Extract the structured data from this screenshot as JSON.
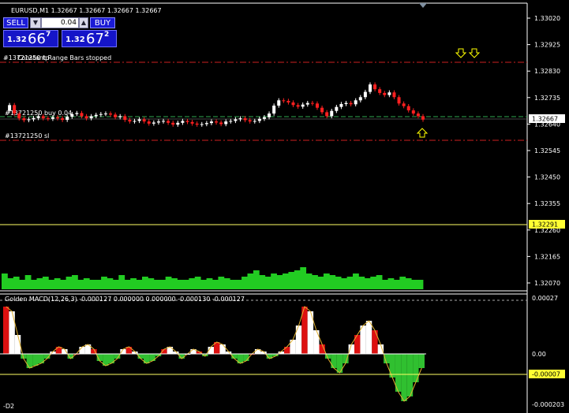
{
  "chart": {
    "title": "EURUSD,M1  1.32667 1.32667 1.32667 1.32667",
    "sell_label": "SELL",
    "buy_label": "BUY",
    "lot_value": "0.04",
    "bid": {
      "small": "1.32",
      "big": "66",
      "sup": "7"
    },
    "ask": {
      "small": "1.32",
      "big": "67",
      "sup": "2"
    },
    "status_text": "Constant Range Bars stopped",
    "tp_line_label": "#13721250 tp",
    "order_label": "#13721250 buy 0.04",
    "sl_label": "#13721250 sl",
    "current_price": "1.32667",
    "hline_price": "1.32291",
    "indicator_label": "Golden MACD(12,26,3) -0.000127 0.000000 0.000000 -0.000130 -0.000127",
    "subwindow_label": "-D2",
    "price_ticks": [
      "1.33020",
      "1.32925",
      "1.32830",
      "1.32735",
      "1.32640",
      "1.32545",
      "1.32450",
      "1.32355",
      "1.32260",
      "1.32165",
      "1.32070"
    ],
    "macd_ticks": [
      "0.00027",
      "0.00",
      "-0.00007",
      "-0.000203"
    ]
  },
  "colors": {
    "background": "#000000",
    "grid_line": "#ffffff",
    "bull": "#ffffff",
    "bear": "#ff2020",
    "volume": "#22cc22",
    "tp_sl_line": "#cc2020",
    "order_line": "#2fa84f",
    "hline": "#ffff66",
    "macd_pos": "#ffffff",
    "macd_neg": "#30c030",
    "macd_hist_red": "#dd1010",
    "arrow": "#ffff00"
  },
  "chart_data": {
    "type": "candlestick",
    "symbol": "EURUSD",
    "timeframe": "M1",
    "ylim": [
      1.3204,
      1.3306
    ],
    "close_series": [
      1.327,
      1.32722,
      1.3269,
      1.32672,
      1.32665,
      1.32668,
      1.32673,
      1.3268,
      1.32672,
      1.3267,
      1.32676,
      1.32672,
      1.32666,
      1.32678,
      1.32688,
      1.32692,
      1.3268,
      1.32672,
      1.3268,
      1.32685,
      1.32688,
      1.3269,
      1.32686,
      1.32676,
      1.3268,
      1.32666,
      1.3266,
      1.32662,
      1.32668,
      1.3266,
      1.32652,
      1.32656,
      1.3266,
      1.32662,
      1.32655,
      1.32648,
      1.32655,
      1.32662,
      1.32658,
      1.32652,
      1.32648,
      1.3265,
      1.32654,
      1.3266,
      1.32656,
      1.3265,
      1.3266,
      1.32662,
      1.32668,
      1.32672,
      1.32665,
      1.3266,
      1.32662,
      1.3267,
      1.32676,
      1.3269,
      1.3272,
      1.3274,
      1.32738,
      1.32732,
      1.32722,
      1.32716,
      1.32724,
      1.3273,
      1.32728,
      1.32712,
      1.32695,
      1.3268,
      1.327,
      1.32715,
      1.32726,
      1.3273,
      1.32725,
      1.3274,
      1.32752,
      1.32772,
      1.328,
      1.32782,
      1.32768,
      1.3276,
      1.3277,
      1.32752,
      1.32728,
      1.32718,
      1.32702,
      1.3269,
      1.3268,
      1.32667
    ],
    "macd_hist": [
      0.0002,
      0.00018,
      8e-05,
      -2e-05,
      -6e-05,
      -5e-05,
      -4e-05,
      -2e-05,
      1e-05,
      3e-05,
      2e-05,
      -2e-05,
      0.0,
      3e-05,
      4e-05,
      2e-05,
      -3e-05,
      -5e-05,
      -4e-05,
      -2e-05,
      2e-05,
      3e-05,
      1e-05,
      -2e-05,
      -4e-05,
      -3e-05,
      -1e-05,
      2e-05,
      3e-05,
      1e-05,
      -2e-05,
      0.0,
      2e-05,
      1e-05,
      -1e-05,
      3e-05,
      5e-05,
      4e-05,
      1e-05,
      -2e-05,
      -4e-05,
      -3e-05,
      0.0,
      2e-05,
      1e-05,
      -2e-05,
      -1e-05,
      1e-05,
      3e-05,
      6e-05,
      0.00012,
      0.0002,
      0.00018,
      0.0001,
      4e-05,
      -2e-05,
      -6e-05,
      -8e-05,
      -4e-05,
      4e-05,
      8e-05,
      0.00012,
      0.00014,
      0.0001,
      4e-05,
      -4e-05,
      -0.0001,
      -0.00016,
      -0.0002,
      -0.00018,
      -0.00012,
      -6e-05
    ],
    "volume": [
      0.5,
      0.35,
      0.4,
      0.3,
      0.45,
      0.3,
      0.35,
      0.4,
      0.3,
      0.35,
      0.3,
      0.4,
      0.45,
      0.3,
      0.35,
      0.3,
      0.3,
      0.4,
      0.35,
      0.3,
      0.45,
      0.3,
      0.35,
      0.3,
      0.4,
      0.35,
      0.3,
      0.3,
      0.4,
      0.35,
      0.3,
      0.3,
      0.35,
      0.4,
      0.3,
      0.35,
      0.3,
      0.4,
      0.35,
      0.3,
      0.3,
      0.4,
      0.5,
      0.6,
      0.45,
      0.4,
      0.5,
      0.45,
      0.5,
      0.55,
      0.6,
      0.7,
      0.5,
      0.45,
      0.4,
      0.5,
      0.45,
      0.4,
      0.35,
      0.4,
      0.5,
      0.4,
      0.35,
      0.4,
      0.45,
      0.3,
      0.35,
      0.3,
      0.4,
      0.35,
      0.3,
      0.3
    ]
  }
}
